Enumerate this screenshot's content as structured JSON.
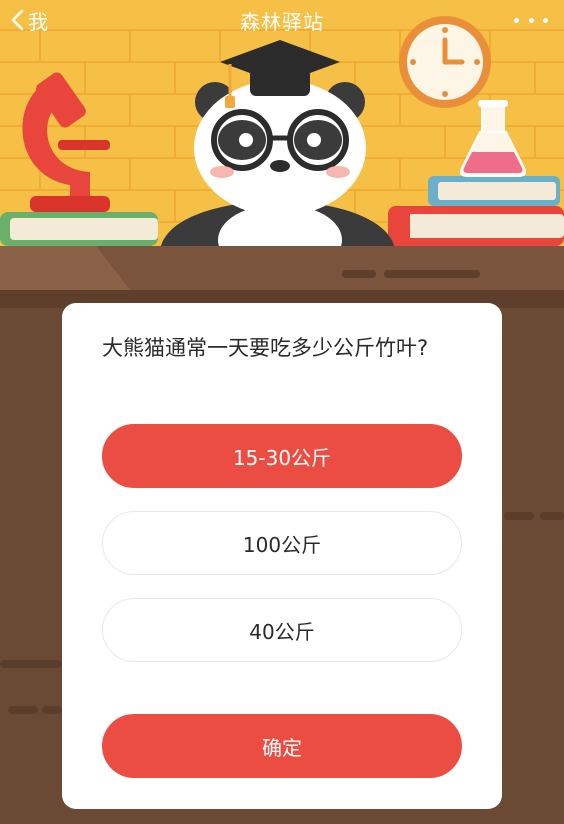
{
  "header": {
    "back_label": "我",
    "title": "森林驿站"
  },
  "quiz": {
    "question": "大熊猫通常一天要吃多少公斤竹叶?",
    "options": [
      {
        "label": "15-30公斤",
        "selected": true
      },
      {
        "label": "100公斤",
        "selected": false
      },
      {
        "label": "40公斤",
        "selected": false
      }
    ],
    "confirm_label": "确定"
  },
  "colors": {
    "accent": "#ec4d43",
    "wall": "#f6bf45",
    "desk": "#7a543c"
  }
}
